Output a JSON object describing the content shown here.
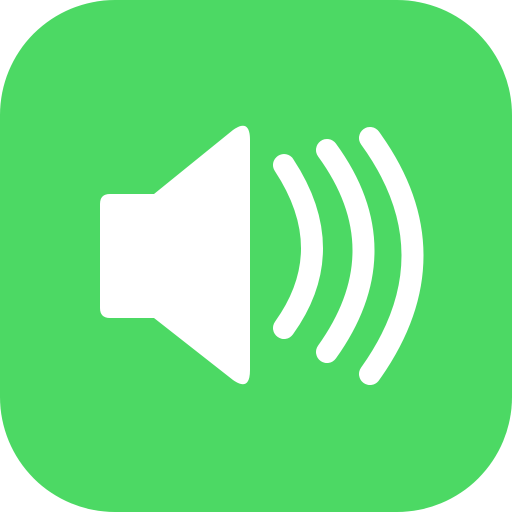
{
  "app_icon": {
    "icon_name": "speaker-volume-icon",
    "colors": {
      "page_background": "#ffffff",
      "tile": "#4cd964",
      "glyph": "#ffffff"
    }
  }
}
